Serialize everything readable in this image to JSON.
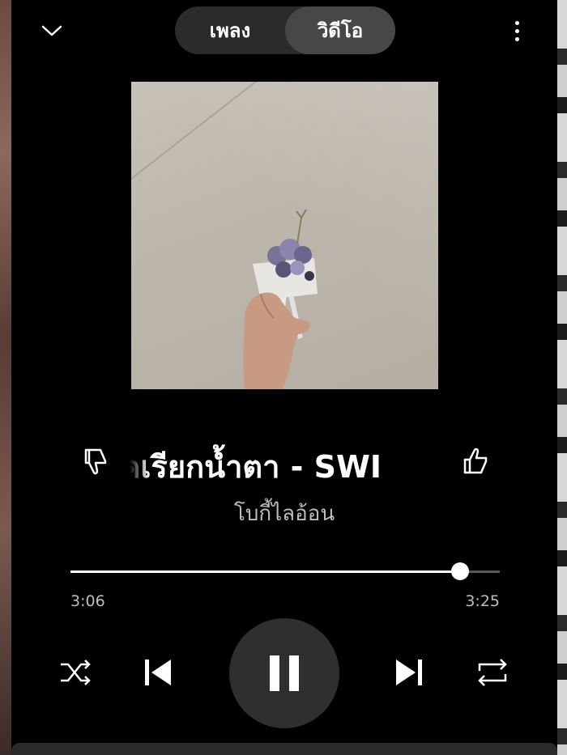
{
  "header": {
    "tabs": [
      {
        "label": "เพลง",
        "active": false
      },
      {
        "label": "วิดีโอ",
        "active": true
      }
    ]
  },
  "track": {
    "title": "คเรียกน้ำตา - SWI",
    "artist": "โบกี้ไลอ้อน"
  },
  "progress": {
    "current": "3:06",
    "total": "3:25",
    "fraction": 0.907
  },
  "icons": {
    "collapse": "chevron-down-icon",
    "more": "more-vertical-icon",
    "dislike": "thumbs-down-icon",
    "like": "thumbs-up-icon",
    "shuffle": "shuffle-icon",
    "previous": "skip-previous-icon",
    "play_pause": "pause-icon",
    "next": "skip-next-icon",
    "repeat": "repeat-icon"
  },
  "colors": {
    "background": "#000000",
    "segment_bg": "#2b2b2b",
    "segment_active": "#474747",
    "play_button_bg": "#2f2f2f",
    "progress_played": "#ffffff",
    "progress_remaining": "#5a5a5a"
  }
}
